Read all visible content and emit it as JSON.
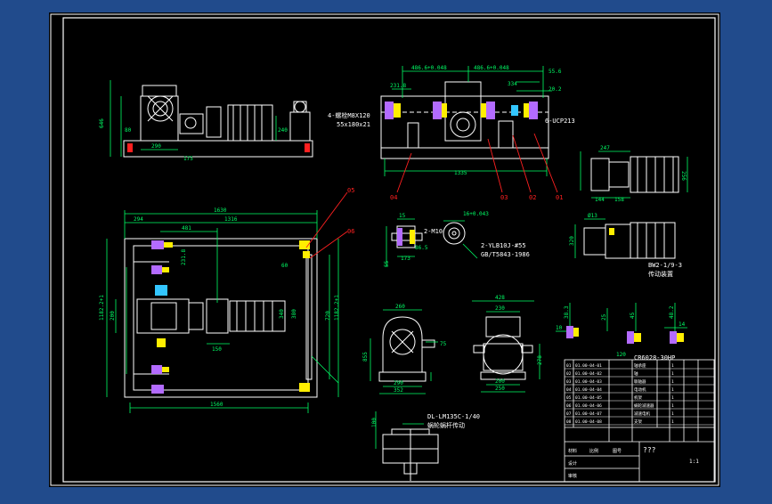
{
  "colors": {
    "background": "#214b8c",
    "sheet": "#000000",
    "frame": "#ffffff",
    "geometry": "#ffffff",
    "dimension": "#00ff66",
    "text": "#ffffff",
    "leader": "#ff2020",
    "component_purple": "#b36bff",
    "component_yellow": "#ffee00",
    "component_cyan": "#33c6ff"
  },
  "top_view": {
    "dims": {
      "height_left": "646",
      "width_290": "290",
      "offset_80": "80",
      "height_240": "240",
      "height_175": "175"
    }
  },
  "front_view": {
    "dims": {
      "d1": "486.6+0.048",
      "d2": "486.6+0.048",
      "d3": "55.6",
      "d4": "231.8",
      "d5": "334",
      "d6": "20.2",
      "overall": "1335"
    },
    "labels": {
      "bolt_spec": "4-螺栓M8X120",
      "bolt_sub": "55x180x21",
      "bearing": "6-UCP213"
    },
    "leaders": [
      "04",
      "03",
      "02",
      "01"
    ]
  },
  "right_motor": {
    "dims": {
      "a": "247",
      "b": "256",
      "c": "144",
      "d": "158"
    }
  },
  "plan_view": {
    "dims": {
      "overall_top": "1630",
      "left_294": "294",
      "inner_1316": "1316",
      "offset_481": "481",
      "height_1182": "1182.2+1",
      "height_200": "200",
      "height_720": "720",
      "right_1182": "1182.2+1",
      "w_150": "150",
      "r_60": "60",
      "d_380": "380",
      "d_340": "340",
      "bottom_1560": "1560",
      "left_231": "231.8"
    },
    "leaders": [
      "05",
      "06"
    ]
  },
  "detail_shaft": {
    "dims": {
      "d15": "15",
      "d16": "16+0.043",
      "mid": "2-M10",
      "w": "86.5",
      "h": "173",
      "h2": "55"
    },
    "labels": {
      "key": "2-YLB10J-#55",
      "standard": "GB/T5843-1986"
    }
  },
  "detail_motor2": {
    "dims": {
      "d13": "Ø13",
      "h": "320"
    },
    "labels": {
      "model": "BW2-1/9-3",
      "sub": "传动装置"
    }
  },
  "gearbox_side": {
    "dims": {
      "top": "260",
      "right": "75",
      "w1": "290",
      "w2": "352",
      "h": "855"
    }
  },
  "gearbox_front": {
    "dims": {
      "top": "428",
      "mid": "230",
      "w1": "200",
      "w2": "250",
      "h": "278"
    }
  },
  "coupling": {
    "dims": {
      "a": "38.3",
      "b": "10",
      "c": "25",
      "d": "45",
      "e": "48.2",
      "f": "14",
      "g": "120"
    },
    "labels": {
      "model": "CR6028-30HP"
    }
  },
  "worm_detail": {
    "labels": {
      "model": "DL-LM135C-1/40",
      "sub": "蜗轮蜗杆传动"
    },
    "dims": {
      "a": "100"
    }
  },
  "title_block": {
    "rows": [
      [
        "01",
        "01.00-04-01",
        "轴承座",
        "1"
      ],
      [
        "02",
        "01.00-04-02",
        "轴",
        "1"
      ],
      [
        "03",
        "01.00-04-03",
        "联轴器",
        "1"
      ],
      [
        "04",
        "01.00-04-04",
        "电动机",
        "1"
      ],
      [
        "05",
        "01.00-04-05",
        "机架",
        "1"
      ],
      [
        "06",
        "01.00-04-06",
        "蜗轮减速器",
        "1"
      ],
      [
        "07",
        "01.00-04-07",
        "减速电机",
        "1"
      ],
      [
        "08",
        "01.00-04-08",
        "支架",
        "1"
      ]
    ],
    "title": "???",
    "sub": "1:1",
    "footer": [
      "材料",
      "比例",
      "图号",
      "设计",
      "审核"
    ]
  }
}
